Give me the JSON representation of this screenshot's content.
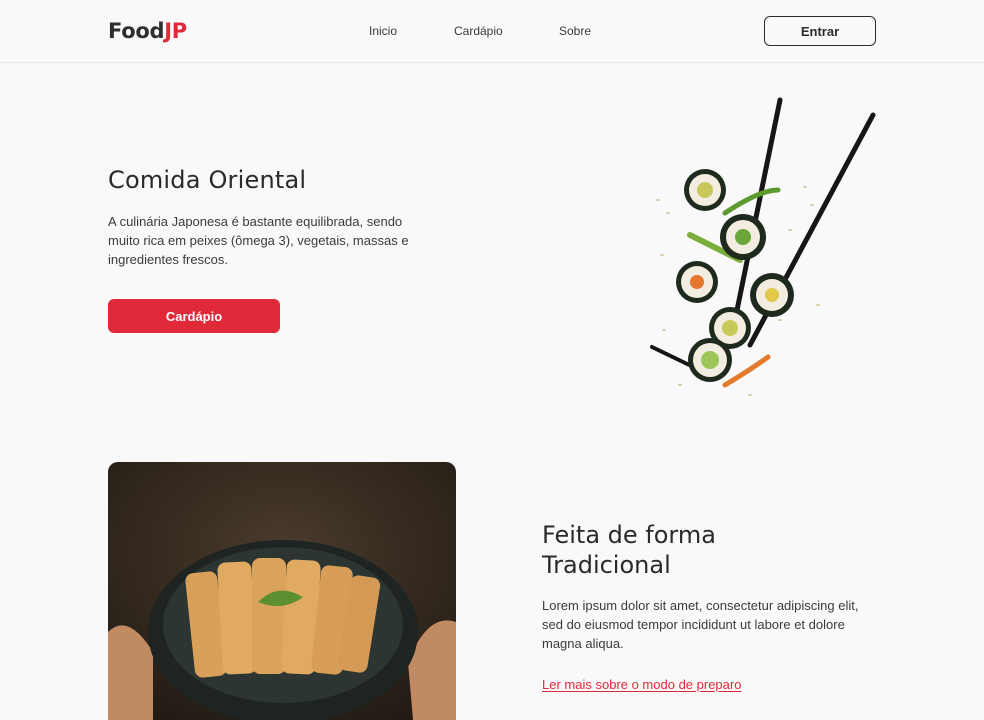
{
  "header": {
    "logo_main": "Food",
    "logo_accent": "JP",
    "nav": [
      "Inicio",
      "Cardápio",
      "Sobre"
    ],
    "login_label": "Entrar"
  },
  "hero": {
    "title": "Comida Oriental",
    "text": "A culinária Japonesa é bastante equilibrada, sendo muito rica em peixes (ômega 3), vegetais, massas e ingredientes frescos.",
    "button_label": "Cardápio",
    "image": "sushi-with-chopsticks"
  },
  "section2": {
    "title": "Feita de forma Tradicional",
    "text": "Lorem ipsum dolor sit amet, consectetur adipiscing elit, sed do eiusmod tempor incididunt ut labore et dolore magna aliqua.",
    "link_label": "Ler mais sobre o modo de preparo",
    "image": "breaded-cutlet-bowl"
  },
  "colors": {
    "accent": "#e02a3a",
    "background": "#f9f9fa",
    "text": "#2b2b2b"
  }
}
